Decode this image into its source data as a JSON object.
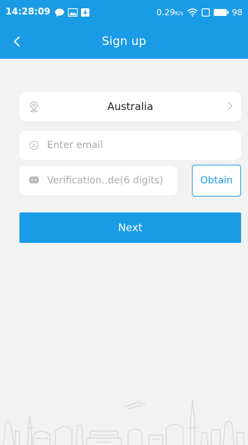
{
  "status_bar": {
    "time": "14:28:09",
    "network_speed": "0.29",
    "network_unit": "K/s",
    "battery_level": "98"
  },
  "header": {
    "title": "Sign up",
    "back_icon": "chevron-left-icon"
  },
  "form": {
    "country": {
      "value": "Australia",
      "icon": "location-pin-icon"
    },
    "email": {
      "placeholder": "Enter email",
      "value": "",
      "icon": "at-sign-icon"
    },
    "code": {
      "placeholder": "Verification..de(6 digits)",
      "value": "",
      "icon": "message-bubble-icon"
    },
    "obtain_label": "Obtain",
    "next_label": "Next"
  },
  "colors": {
    "primary": "#1a9be6",
    "background": "#f2f2f2",
    "field": "#ffffff",
    "placeholder": "#aaaaaa"
  }
}
